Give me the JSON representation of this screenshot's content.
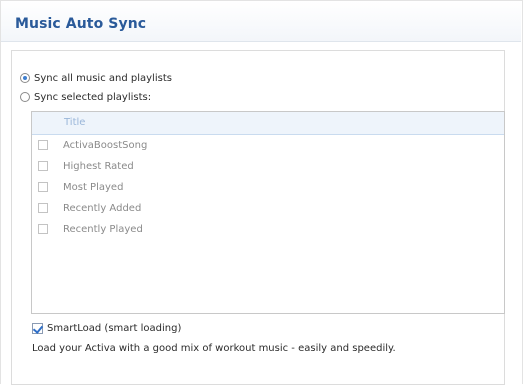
{
  "window": {
    "title": "Music Auto Sync"
  },
  "sync_options": [
    {
      "label": "Sync all music and playlists",
      "selected": true
    },
    {
      "label": "Sync selected playlists:",
      "selected": false
    }
  ],
  "playlist_list": {
    "column_header": "Title",
    "items": [
      {
        "label": "ActivaBoostSong",
        "checked": false
      },
      {
        "label": "Highest Rated",
        "checked": false
      },
      {
        "label": "Most Played",
        "checked": false
      },
      {
        "label": "Recently Added",
        "checked": false
      },
      {
        "label": "Recently Played",
        "checked": false
      }
    ]
  },
  "smartload": {
    "label": "SmartLoad (smart loading)",
    "checked": true
  },
  "description": "Load your Activa with a good mix of workout music - easily and speedily.",
  "colors": {
    "title": "#2a5a9a",
    "accent": "#3f7fcf",
    "header_bg": "#eef4fb"
  }
}
